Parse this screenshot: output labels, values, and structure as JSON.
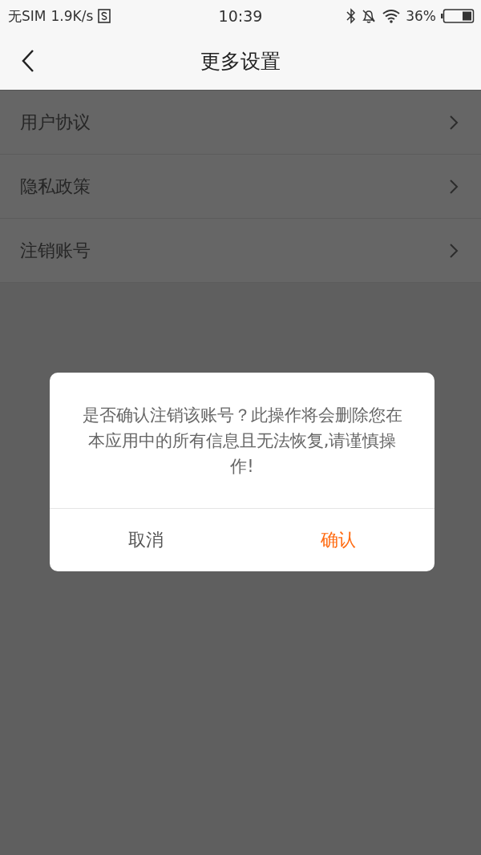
{
  "status_bar": {
    "carrier": "无SIM",
    "speed": "1.9K/s",
    "time": "10:39",
    "battery": "36%"
  },
  "header": {
    "title": "更多设置"
  },
  "settings_items": [
    {
      "label": "用户协议"
    },
    {
      "label": "隐私政策"
    },
    {
      "label": "注销账号"
    }
  ],
  "dialog": {
    "message": "是否确认注销该账号？此操作将会删除您在本应用中的所有信息且无法恢复,请谨慎操作!",
    "buttons": [
      {
        "label": "取消",
        "kind": "cancel"
      },
      {
        "label": "确认",
        "kind": "confirm"
      }
    ]
  }
}
